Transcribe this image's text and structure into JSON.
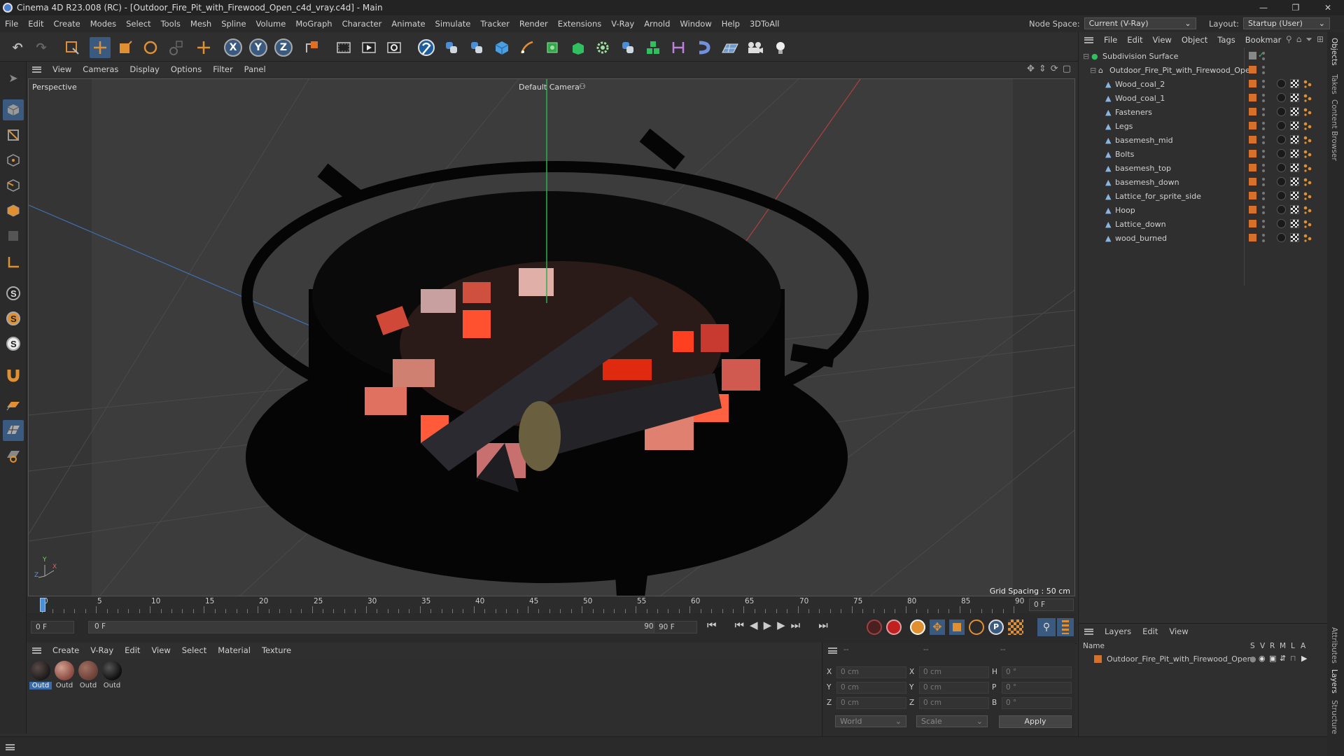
{
  "window": {
    "title": "Cinema 4D R23.008 (RC) - [Outdoor_Fire_Pit_with_Firewood_Open_c4d_vray.c4d] - Main",
    "minimize": "—",
    "maximize": "❐",
    "close": "✕"
  },
  "menubar": {
    "items": [
      "File",
      "Edit",
      "Create",
      "Modes",
      "Select",
      "Tools",
      "Mesh",
      "Spline",
      "Volume",
      "MoGraph",
      "Character",
      "Animate",
      "Simulate",
      "Tracker",
      "Render",
      "Extensions",
      "V-Ray",
      "Arnold",
      "Window",
      "Help",
      "3DToAll"
    ],
    "node_space_label": "Node Space:",
    "node_space_value": "Current (V-Ray)",
    "layout_label": "Layout:",
    "layout_value": "Startup (User)"
  },
  "toolbar": {
    "undo": "↶",
    "redo": "↷",
    "axis_x": "X",
    "axis_y": "Y",
    "axis_z": "Z",
    "icons": [
      "live-selection-icon",
      "move-icon",
      "scale-icon",
      "rotate-icon",
      "recent-tool-icon",
      "render-region-icon",
      "render-view-icon",
      "render-settings-icon",
      "vray-icon",
      "python-icon",
      "python-icon",
      "cube-icon",
      "pen-icon",
      "subdivision-icon",
      "extrude-icon",
      "cloner-icon",
      "python-icon",
      "mograph-icon",
      "deformer-icon",
      "magnet-icon",
      "floor-icon",
      "camera-icon",
      "light-icon"
    ]
  },
  "left_tools": {
    "icons": [
      "model-mode-icon",
      "texture-mode-icon",
      "point-mode-icon",
      "edge-mode-icon",
      "polygon-mode-icon",
      "uv-mode-icon",
      "axis-mode-icon",
      "snap-icon",
      "snap-icon",
      "snap-icon",
      "magnet-icon",
      "grid-icon",
      "workplane-icon",
      "lock-icon"
    ]
  },
  "viewport": {
    "menu": [
      "View",
      "Cameras",
      "Display",
      "Options",
      "Filter",
      "Panel"
    ],
    "label": "Perspective",
    "camera": "Default Camera",
    "grid_spacing": "Grid Spacing : 50 cm",
    "axis_x": "X",
    "axis_y": "Y",
    "axis_z": "Z"
  },
  "timeline": {
    "ticks": [
      "0",
      "5",
      "10",
      "15",
      "20",
      "25",
      "30",
      "35",
      "40",
      "45",
      "50",
      "55",
      "60",
      "65",
      "70",
      "75",
      "80",
      "85",
      "90"
    ],
    "current_frame_field": "0 F",
    "start_field": "0 F",
    "range_start": "0 F",
    "range_end": "90 F",
    "end_field": "90 F",
    "playhead_frame": 0
  },
  "transport": {
    "buttons": [
      "⏮",
      "⏭",
      "◀",
      "▶",
      "▶",
      "⏭"
    ],
    "play_symbol": "▶"
  },
  "materials": {
    "menu": [
      "Create",
      "V-Ray",
      "Edit",
      "View",
      "Select",
      "Material",
      "Texture"
    ],
    "items": [
      {
        "label": "Outd",
        "color": "#1c1a1a",
        "selected": true
      },
      {
        "label": "Outd",
        "color": "#8a4a40",
        "selected": false
      },
      {
        "label": "Outd",
        "color": "#6a4038",
        "selected": false
      },
      {
        "label": "Outd",
        "color": "#0e0e0e",
        "selected": false
      }
    ]
  },
  "coords": {
    "header_dashes": [
      "--",
      "--",
      "--"
    ],
    "rows": [
      {
        "a": "X",
        "av": "0 cm",
        "b": "X",
        "bv": "0 cm",
        "c": "H",
        "cv": "0 °"
      },
      {
        "a": "Y",
        "av": "0 cm",
        "b": "Y",
        "bv": "0 cm",
        "c": "P",
        "cv": "0 °"
      },
      {
        "a": "Z",
        "av": "0 cm",
        "b": "Z",
        "bv": "0 cm",
        "c": "B",
        "cv": "0 °"
      }
    ],
    "world": "World",
    "scale": "Scale",
    "apply": "Apply"
  },
  "objects": {
    "menu": [
      "File",
      "Edit",
      "View",
      "Object",
      "Tags",
      "Bookmar"
    ],
    "root": "Subdivision Surface",
    "group": "Outdoor_Fire_Pit_with_Firewood_Open",
    "children": [
      "Wood_coal_2",
      "Wood_coal_1",
      "Fasteners",
      "Legs",
      "basemesh_mid",
      "Bolts",
      "basemesh_top",
      "basemesh_down",
      "Lattice_for_sprite_side",
      "Hoop",
      "Lattice_down",
      "wood_burned"
    ]
  },
  "layers": {
    "menu": [
      "Layers",
      "Edit",
      "View"
    ],
    "col_name": "Name",
    "cols": [
      "S",
      "V",
      "R",
      "M",
      "L",
      "A"
    ],
    "row": "Outdoor_Fire_Pit_with_Firewood_Open"
  },
  "right_tabs": [
    "Objects",
    "Takes",
    "Content Browser",
    "Attributes",
    "Layers",
    "Structure"
  ],
  "colors": {
    "accent_blue": "#4a8fd6",
    "tag_orange": "#d6702a",
    "bg": "#2e2e2e"
  }
}
